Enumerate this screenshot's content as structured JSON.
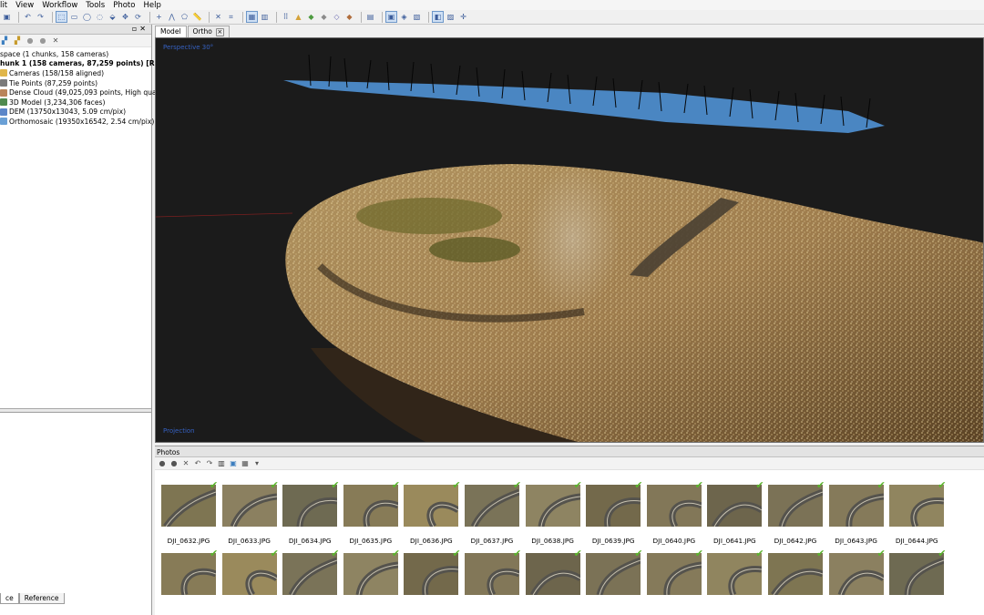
{
  "menu": [
    "lit",
    "View",
    "Workflow",
    "Tools",
    "Photo",
    "Help"
  ],
  "workspace": {
    "tree": [
      {
        "label": "space (1 chunks, 158 cameras)",
        "bold": false,
        "color": ""
      },
      {
        "label": "hunk 1 (158 cameras, 87,259 points) [R]",
        "bold": true,
        "color": ""
      },
      {
        "label": "Cameras (158/158 aligned)",
        "bold": false,
        "color": "#e0b64a"
      },
      {
        "label": "Tie Points (87,259 points)",
        "bold": false,
        "color": "#7a7a7a"
      },
      {
        "label": "Dense Cloud (49,025,093 points, High quality)",
        "bold": false,
        "color": "#b9845a"
      },
      {
        "label": "3D Model (3,234,306 faces)",
        "bold": false,
        "color": "#4f8a4f"
      },
      {
        "label": "DEM (13750x13043, 5.09 cm/pix)",
        "bold": false,
        "color": "#5b86c8"
      },
      {
        "label": "Orthomosaic (19350x16542, 2.54 cm/pix)",
        "bold": false,
        "color": "#6aa0d6"
      }
    ],
    "bottom_tabs": [
      "ce",
      "Reference"
    ]
  },
  "view_tabs": [
    {
      "label": "Model",
      "closable": false
    },
    {
      "label": "Ortho",
      "closable": true
    }
  ],
  "viewport": {
    "label_top": "Perspective 30°",
    "label_bottom": "Projection"
  },
  "photos": {
    "title": "Photos",
    "row1": [
      "DJI_0632.JPG",
      "DJI_0633.JPG",
      "DJI_0634.JPG",
      "DJI_0635.JPG",
      "DJI_0636.JPG",
      "DJI_0637.JPG",
      "DJI_0638.JPG",
      "DJI_0639.JPG",
      "DJI_0640.JPG",
      "DJI_0641.JPG",
      "DJI_0642.JPG",
      "DJI_0643.JPG",
      "DJI_0644.JPG"
    ],
    "row2_count": 13,
    "aligned_check": "✔"
  },
  "colors": {
    "viewport_bg": "#1b1b1b",
    "dense_cloud": "#c7a870",
    "ortho_blue": "#4e8fd0",
    "check_green": "#5ab52c"
  }
}
